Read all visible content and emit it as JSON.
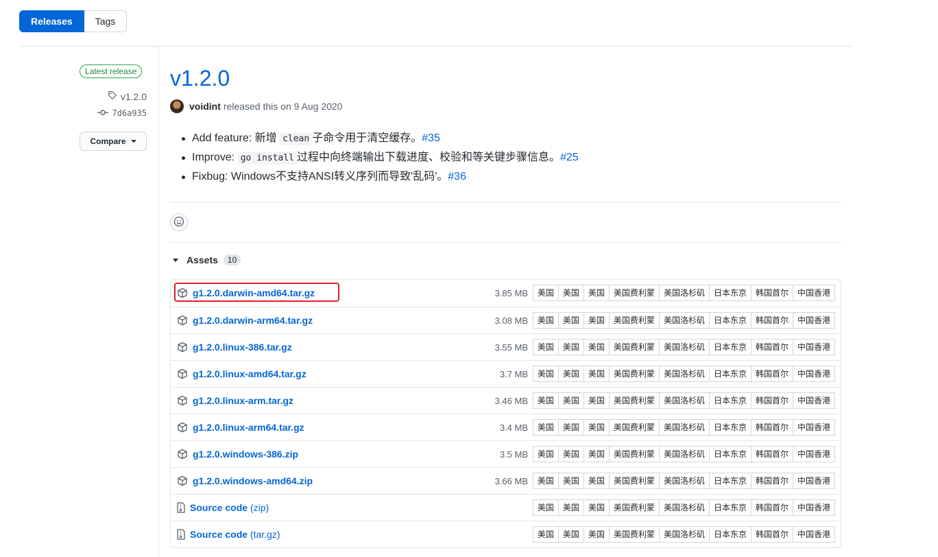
{
  "tabs": {
    "releases": "Releases",
    "tags": "Tags"
  },
  "sidebar": {
    "latest_label": "Latest release",
    "tag": "v1.2.0",
    "commit": "7d6a935",
    "compare_label": "Compare"
  },
  "release": {
    "title": "v1.2.0",
    "author": "voidint",
    "released_text": "released this on 9 Aug 2020",
    "notes": [
      {
        "before": "Add feature: 新增",
        "code": "clean",
        "after": "子命令用于清空缓存。",
        "link": "#35"
      },
      {
        "before": "Improve:",
        "code": "go install",
        "after": "过程中向终端输出下载进度、校验和等关键步骤信息。",
        "link": "#25"
      },
      {
        "before": "Fixbug: Windows不支持ANSI转义序列而导致'乱码'。",
        "code": "",
        "after": "",
        "link": "#36"
      }
    ]
  },
  "assets": {
    "label": "Assets",
    "count": "10",
    "mirrors": [
      "美国",
      "美国",
      "美国",
      "美国费利蒙",
      "美国洛杉矶",
      "日本东京",
      "韩国首尔",
      "中国香港"
    ],
    "items": [
      {
        "name": "g1.2.0.darwin-amd64.tar.gz",
        "size": "3.85 MB"
      },
      {
        "name": "g1.2.0.darwin-arm64.tar.gz",
        "size": "3.08 MB"
      },
      {
        "name": "g1.2.0.linux-386.tar.gz",
        "size": "3.55 MB"
      },
      {
        "name": "g1.2.0.linux-amd64.tar.gz",
        "size": "3.7 MB"
      },
      {
        "name": "g1.2.0.linux-arm.tar.gz",
        "size": "3.46 MB"
      },
      {
        "name": "g1.2.0.linux-arm64.tar.gz",
        "size": "3.4 MB"
      },
      {
        "name": "g1.2.0.windows-386.zip",
        "size": "3.5 MB"
      },
      {
        "name": "g1.2.0.windows-amd64.zip",
        "size": "3.66 MB"
      }
    ],
    "sources": [
      {
        "name": "Source code",
        "ext": "(zip)"
      },
      {
        "name": "Source code",
        "ext": "(tar.gz)"
      }
    ]
  },
  "colors": {
    "accent": "#0366d6",
    "highlight": "#e0202a",
    "latest": "#28a745"
  }
}
